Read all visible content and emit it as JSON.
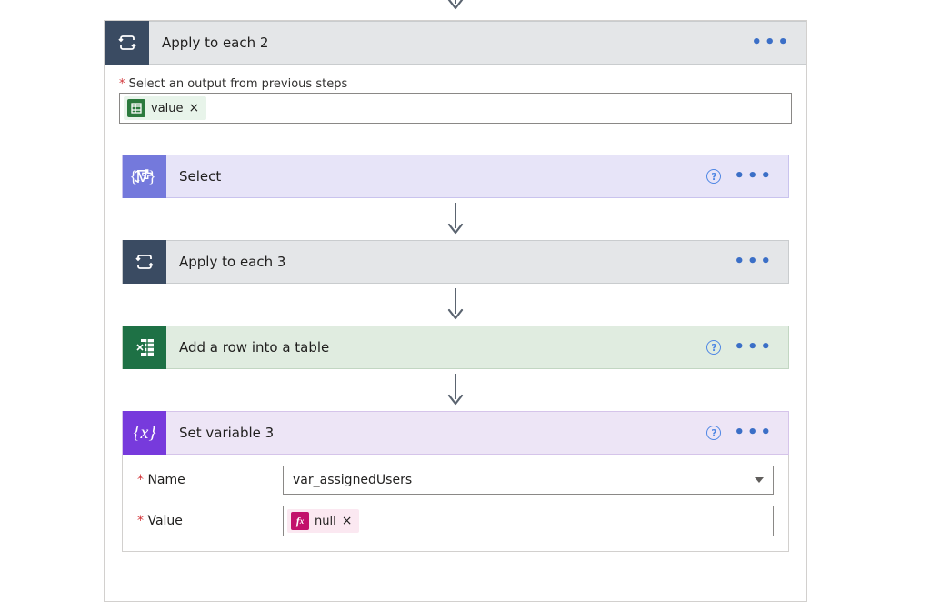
{
  "outer": {
    "title": "Apply to each 2",
    "output_label": "Select an output from previous steps",
    "output_token": "value",
    "icon": "loop-icon"
  },
  "steps": [
    {
      "id": "select",
      "title": "Select",
      "color": "lavender",
      "icon": "select-icon",
      "has_help": true
    },
    {
      "id": "applyeach3",
      "title": "Apply to each 3",
      "color": "grey",
      "icon": "loop-icon",
      "has_help": false
    },
    {
      "id": "addrow",
      "title": "Add a row into a table",
      "color": "green",
      "icon": "excel-icon",
      "has_help": true
    },
    {
      "id": "setvar3",
      "title": "Set variable 3",
      "color": "purple",
      "icon": "variable-icon",
      "has_help": true,
      "form": {
        "name_label": "Name",
        "name_value": "var_assignedUsers",
        "value_label": "Value",
        "value_token": "null"
      }
    }
  ]
}
